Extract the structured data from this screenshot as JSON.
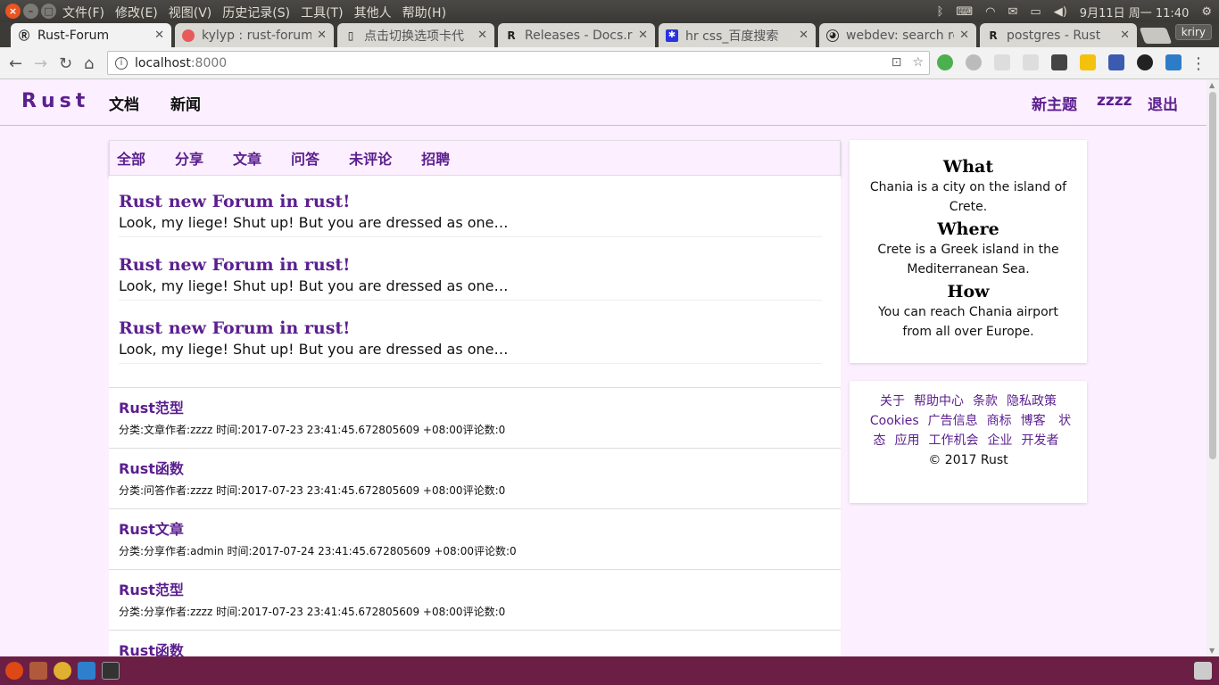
{
  "os": {
    "menu": [
      "文件(F)",
      "修改(E)",
      "视图(V)",
      "历史记录(S)",
      "工具(T)",
      "其他人",
      "帮助(H)"
    ],
    "clock": "9月11日 周一 11:40"
  },
  "tabs": [
    {
      "title": "Rust-Forum",
      "icon": "rust-logo-icon"
    },
    {
      "title": "kylyp : rust-forum",
      "icon": "github-icon"
    },
    {
      "title": "点击切换选项卡代",
      "icon": "page-icon"
    },
    {
      "title": "Releases - Docs.rs",
      "icon": "rust-logo-icon"
    },
    {
      "title": "hr css_百度搜索",
      "icon": "baidu-paw-icon"
    },
    {
      "title": "webdev: search re",
      "icon": "reddit-icon"
    },
    {
      "title": "postgres - Rust",
      "icon": "rust-logo-icon"
    }
  ],
  "profile": "kriry",
  "omnibox": {
    "host": "localhost",
    "port": ":8000"
  },
  "site": {
    "brand": "Rust",
    "nav": [
      "文档",
      "新闻"
    ],
    "right_nav": [
      "新主题",
      "zzzz",
      "退出"
    ]
  },
  "categories": [
    "全部",
    "分享",
    "文章",
    "问答",
    "未评论",
    "招聘"
  ],
  "featured": [
    {
      "title": "Rust new Forum in rust!",
      "body": "Look, my liege! Shut up! But you are dressed as one…"
    },
    {
      "title": "Rust new Forum in rust!",
      "body": "Look, my liege! Shut up! But you are dressed as one…"
    },
    {
      "title": "Rust new Forum in rust!",
      "body": "Look, my liege! Shut up! But you are dressed as one…"
    }
  ],
  "posts": [
    {
      "title": "Rust范型",
      "meta": "分类:文章作者:zzzz 时间:2017-07-23 23:41:45.672805609 +08:00评论数:0"
    },
    {
      "title": "Rust函数",
      "meta": "分类:问答作者:zzzz 时间:2017-07-23 23:41:45.672805609 +08:00评论数:0"
    },
    {
      "title": "Rust文章",
      "meta": "分类:分享作者:admin 时间:2017-07-24 23:41:45.672805609 +08:00评论数:0"
    },
    {
      "title": "Rust范型",
      "meta": "分类:分享作者:zzzz 时间:2017-07-23 23:41:45.672805609 +08:00评论数:0"
    },
    {
      "title": "Rust函数",
      "meta": ""
    }
  ],
  "sidebar": {
    "what_title": "What",
    "what_text": "Chania is a city on the island of Crete.",
    "where_title": "Where",
    "where_text": "Crete is a Greek island in the Mediterranean Sea.",
    "how_title": "How",
    "how_text": "You can reach Chania airport from all over Europe."
  },
  "footer": {
    "links": [
      "关于",
      "帮助中心",
      "条款",
      "隐私政策",
      "Cookies",
      "广告信息",
      "商标",
      "博客",
      "状态",
      "应用",
      "工作机会",
      "企业",
      "开发者"
    ],
    "copyright": "© 2017 Rust"
  },
  "colors": {
    "brand": "#5b1f8f",
    "page_bg": "#fcefff",
    "launcher": "#6b1f45"
  }
}
